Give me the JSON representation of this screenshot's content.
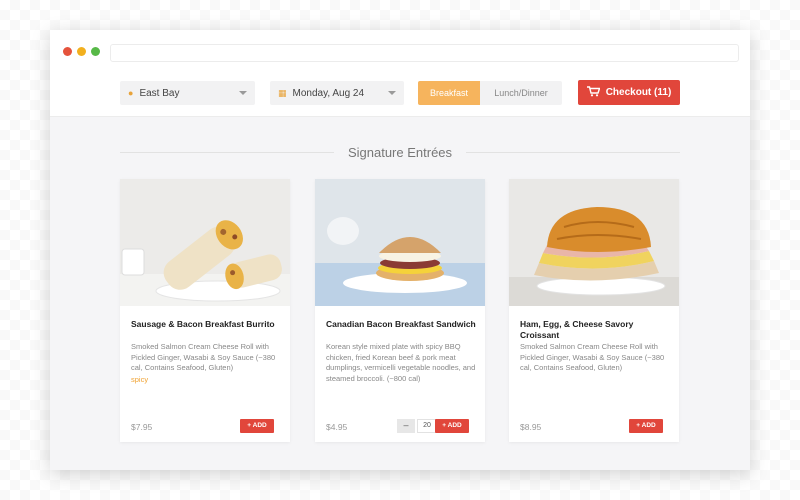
{
  "toolbar": {
    "location": "East Bay",
    "date": "Monday, Aug 24",
    "meal_options": [
      "Breakfast",
      "Lunch/Dinner"
    ],
    "selected_meal": "Breakfast",
    "checkout_label": "Checkout (11)"
  },
  "section": {
    "title": "Signature Entrées"
  },
  "items": [
    {
      "name": "Sausage & Bacon Breakfast Burrito",
      "description": "Smoked Salmon Cream Cheese Roll with Pickled Ginger, Wasabi & Soy Sauce (~380 cal, Contains Seafood, Gluten)",
      "tag": "spicy",
      "price": "$7.95",
      "add_label": "+ ADD"
    },
    {
      "name": "Canadian Bacon Breakfast Sandwich",
      "description": "Korean style mixed plate with spicy BBQ chicken, fried Korean beef & pork meat dumplings, vermicelli vegetable noodles, and steamed broccoli. (~800 cal)",
      "price": "$4.95",
      "quantity_minus": "–",
      "quantity": "20",
      "add_label": "+ ADD"
    },
    {
      "name": "Ham, Egg, & Cheese Savory Croissant",
      "description": "Smoked Salmon Cream Cheese Roll with Pickled Ginger, Wasabi & Soy Sauce (~380 cal, Contains Seafood, Gluten)",
      "price": "$8.95",
      "add_label": "+ ADD"
    }
  ],
  "icons": {
    "location": "map-pin-icon",
    "date": "calendar-icon",
    "cart": "shopping-cart-icon",
    "caret": "chevron-down-icon"
  },
  "colors": {
    "accent_red": "#e1463b",
    "accent_orange": "#f6b45d",
    "spicy_tag": "#f0a232"
  }
}
